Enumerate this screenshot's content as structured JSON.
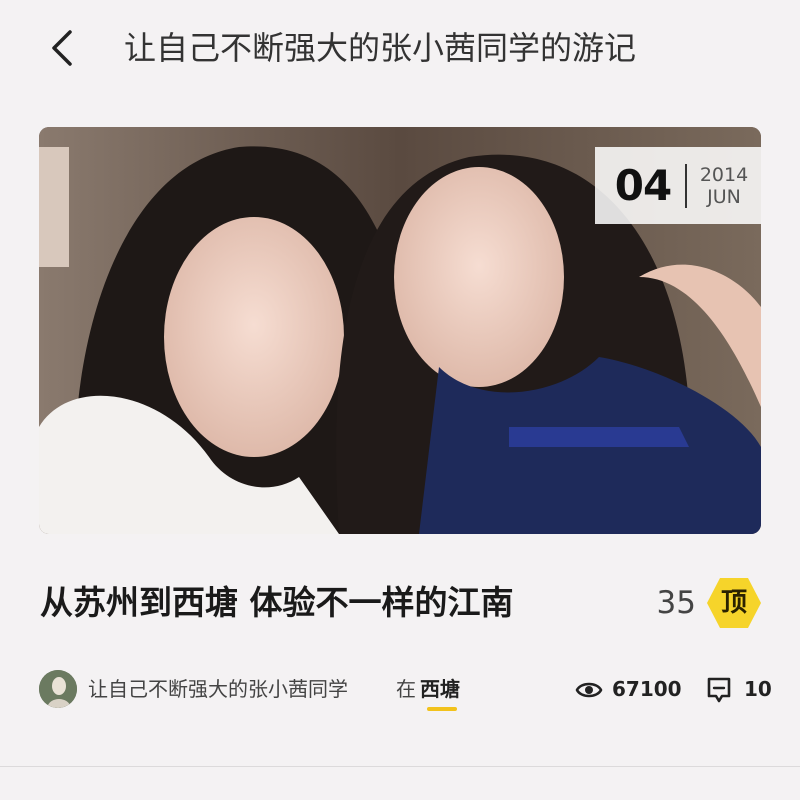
{
  "header": {
    "back_icon": "chevron-left-icon",
    "title": "让自己不断强大的张小茜同学的游记"
  },
  "cover": {
    "alt": "two women selfie",
    "date": {
      "day": "04",
      "year": "2014",
      "month": "JUN"
    }
  },
  "article": {
    "title": "从苏州到西塘 体验不一样的江南",
    "top_count": "35",
    "top_label": "顶"
  },
  "meta": {
    "author": "让自己不断强大的张小茜同学",
    "in_label": "在",
    "location": "西塘",
    "views": "67100",
    "comments": "10",
    "view_icon": "eye-icon",
    "comment_icon": "comment-icon"
  },
  "colors": {
    "accent": "#f2c21b",
    "background": "#f4f2f3",
    "text": "#2a2a2a"
  }
}
